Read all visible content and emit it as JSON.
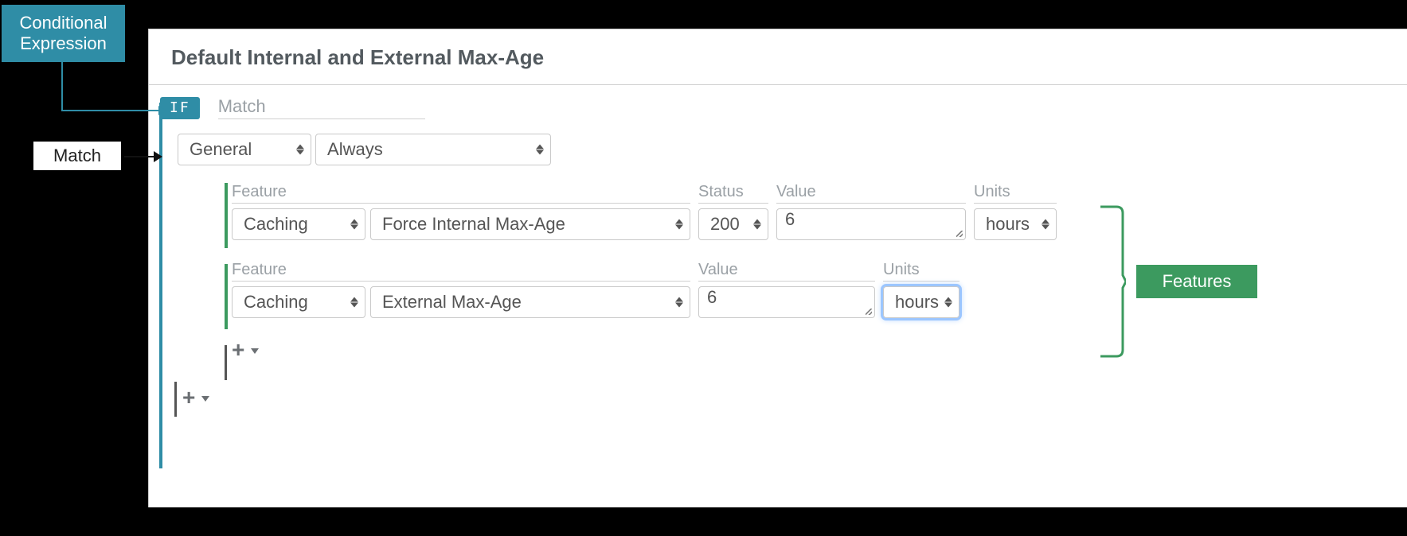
{
  "annotations": {
    "conditional_expression": "Conditional Expression",
    "match": "Match",
    "features": "Features"
  },
  "rule": {
    "name": "Default Internal and External Max-Age",
    "if_badge": "IF",
    "if_label": "Match"
  },
  "match": {
    "category": "General",
    "condition": "Always"
  },
  "labels": {
    "feature": "Feature",
    "status": "Status",
    "value": "Value",
    "units": "Units"
  },
  "features_rows": [
    {
      "category": "Caching",
      "name": "Force Internal Max-Age",
      "status": "200",
      "value": "6",
      "units": "hours"
    },
    {
      "category": "Caching",
      "name": "External Max-Age",
      "value": "6",
      "units": "hours"
    }
  ],
  "icons": {
    "plus": "+"
  }
}
